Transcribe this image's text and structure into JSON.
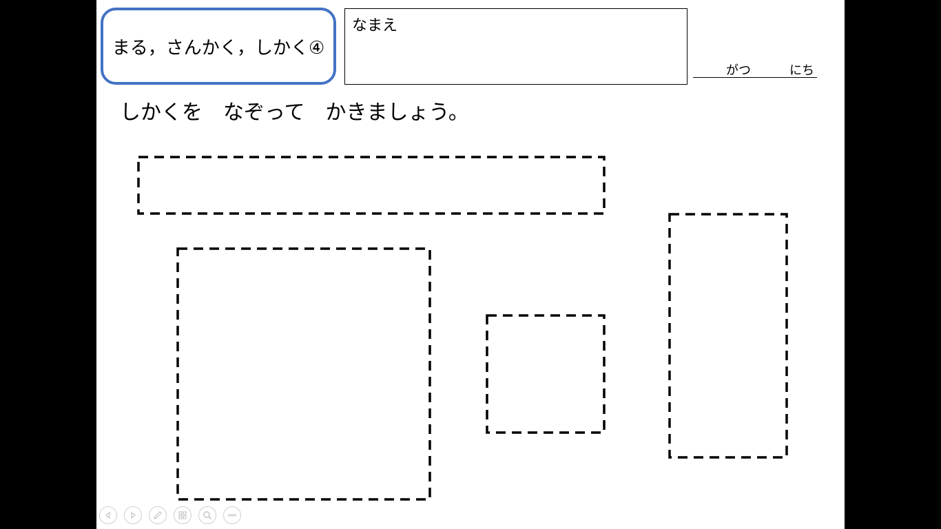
{
  "worksheet": {
    "title": "まる，さんかく，しかく④",
    "name_label": "なまえ",
    "date_month": "がつ",
    "date_day": "にち",
    "instruction": "しかくを　なぞって　かきましょう。"
  },
  "colors": {
    "title_border": "#4472c4",
    "background": "#000000",
    "slide": "#ffffff"
  },
  "rectangles": [
    {
      "name": "wide-rectangle"
    },
    {
      "name": "large-square"
    },
    {
      "name": "small-square"
    },
    {
      "name": "tall-rectangle"
    }
  ],
  "controls": [
    {
      "icon": "previous-slide-icon"
    },
    {
      "icon": "next-slide-icon"
    },
    {
      "icon": "pen-icon"
    },
    {
      "icon": "slides-grid-icon"
    },
    {
      "icon": "zoom-icon"
    },
    {
      "icon": "more-options-icon"
    }
  ]
}
